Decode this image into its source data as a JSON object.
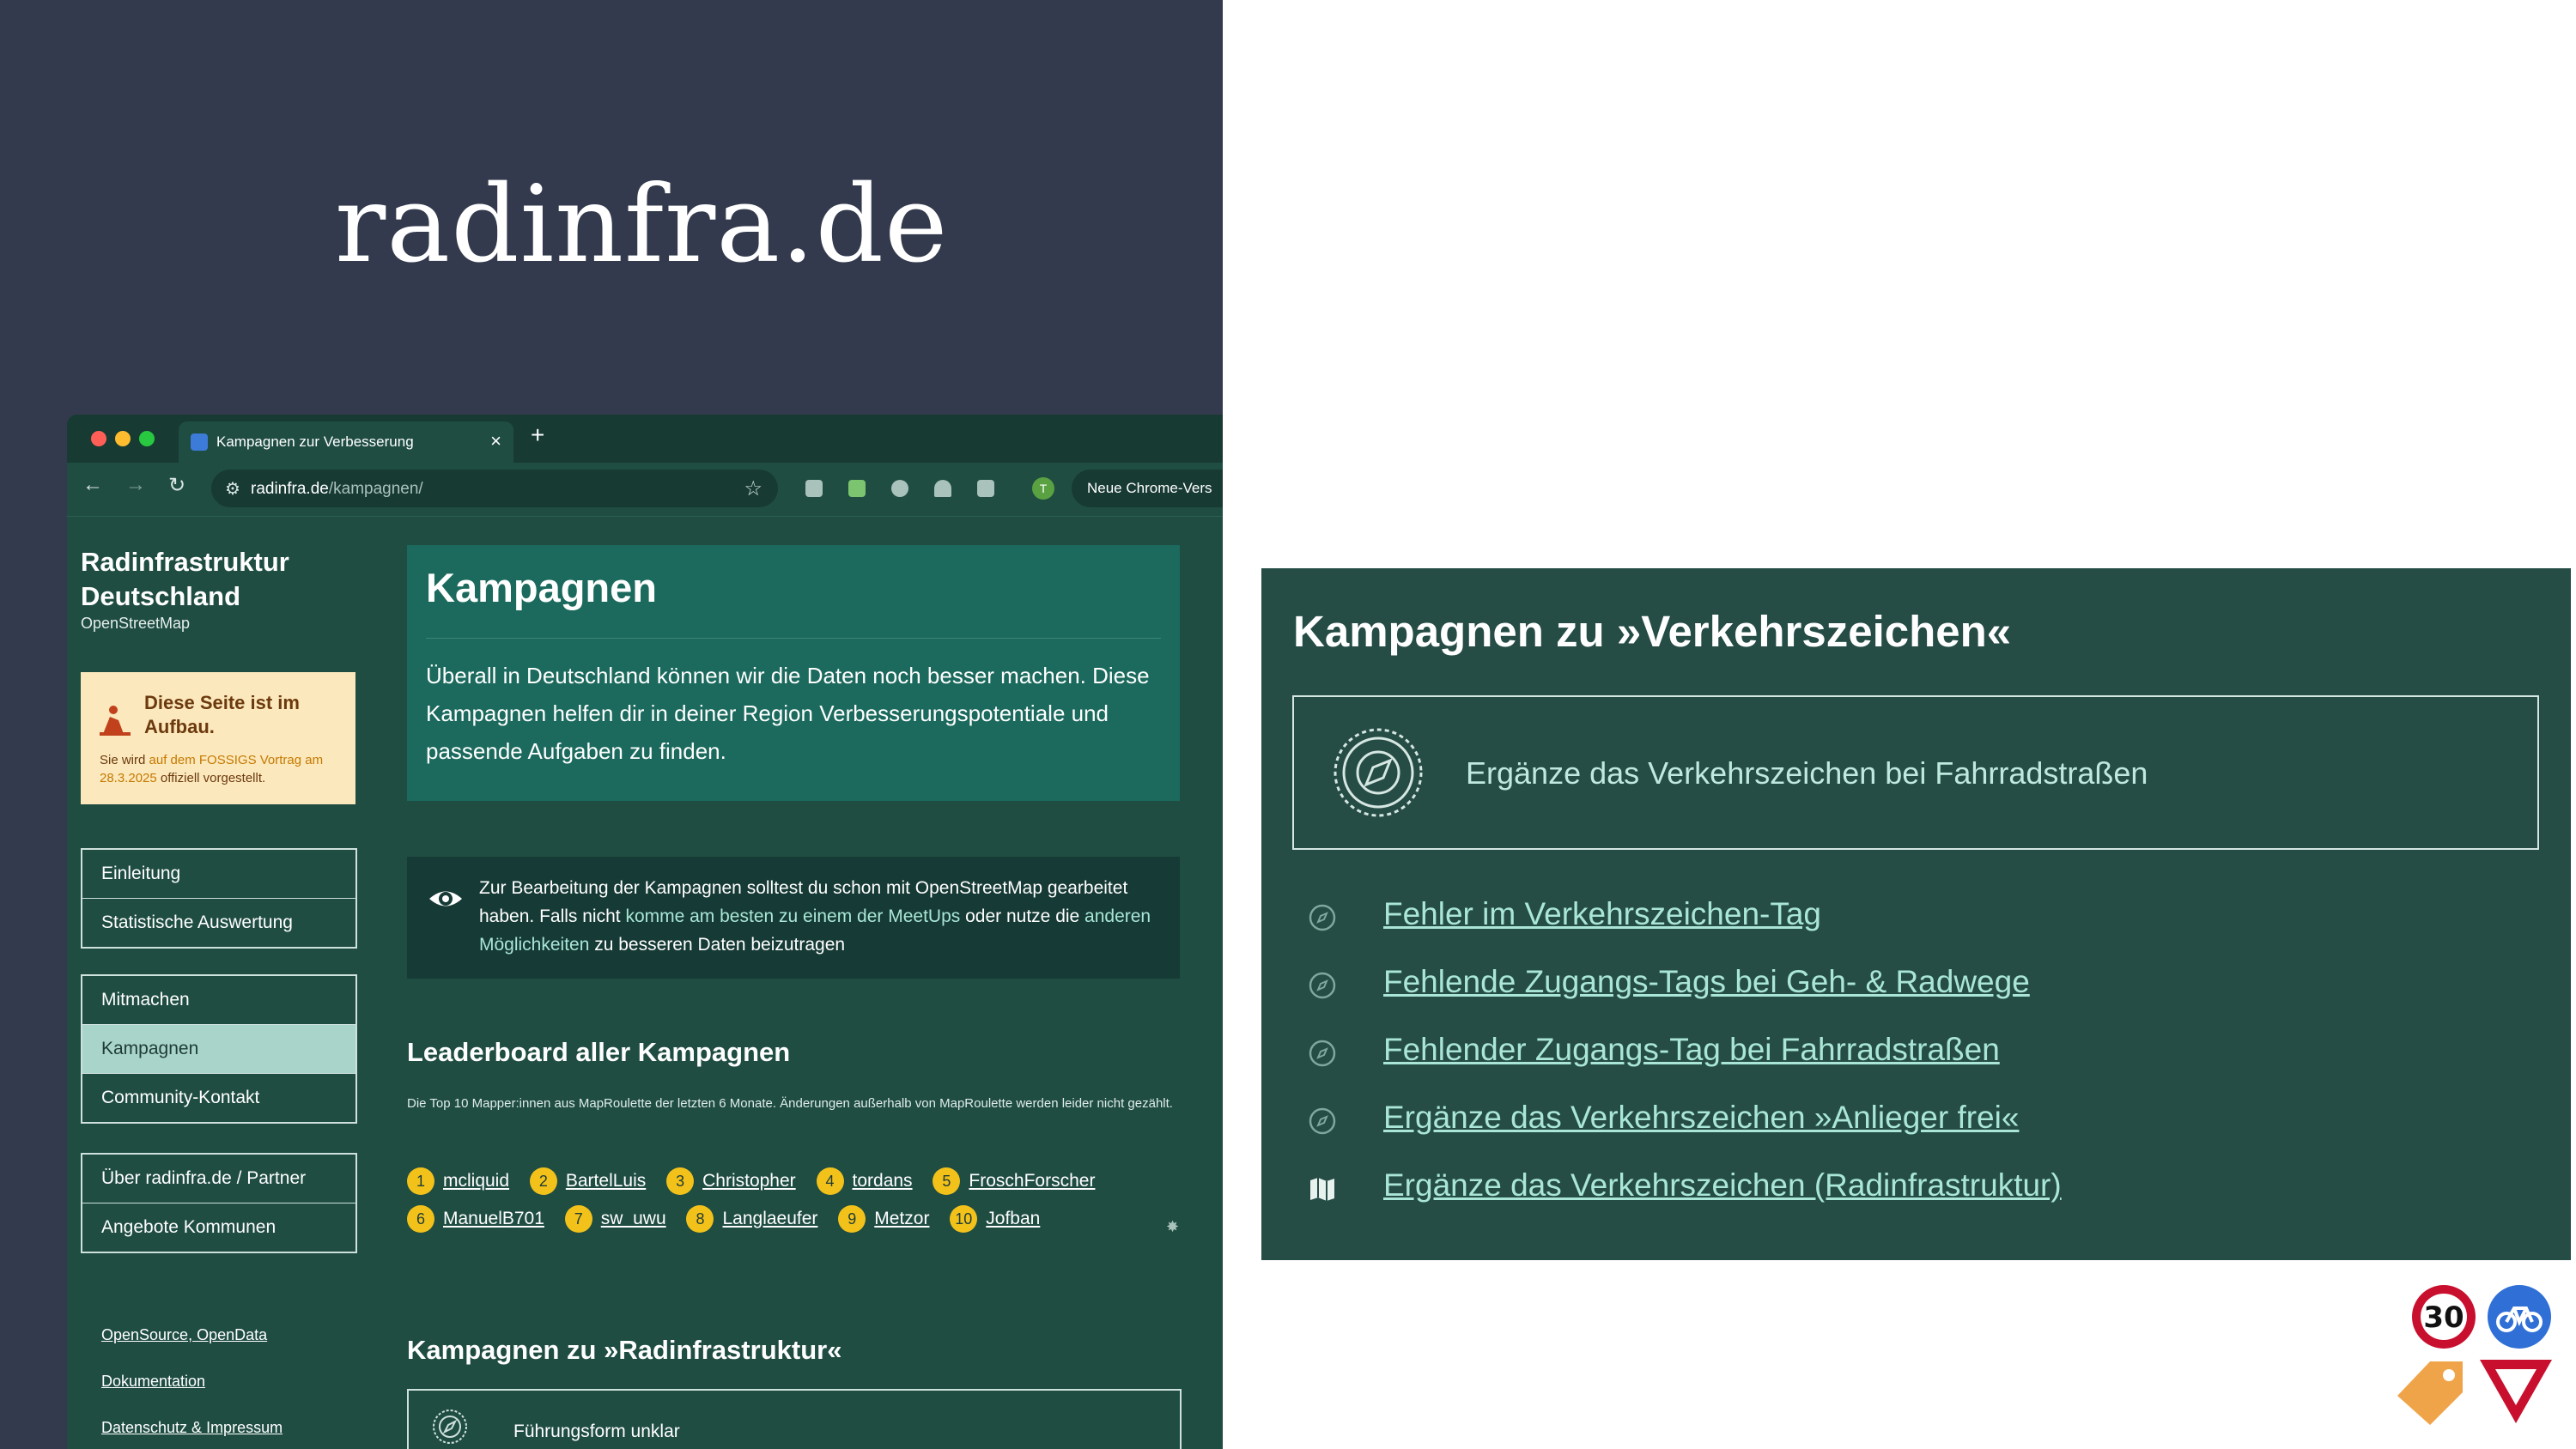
{
  "slide": {
    "title": "radinfra.de"
  },
  "browser": {
    "tab_title": "Kampagnen zur Verbesserung",
    "tab_close": "×",
    "tab_new": "+",
    "url_host": "radinfra.de",
    "url_path": "/kampagnen/",
    "avatar": "T",
    "chrome_button": "Neue Chrome-Vers"
  },
  "site": {
    "title": "Radinfrastruktur Deutschland",
    "subtitle": "OpenStreetMap",
    "notice": {
      "title": "Diese Seite ist im Aufbau.",
      "text_pre": "Sie wird ",
      "link": "auf dem FOSSIGS Vortrag am 28.3.2025",
      "text_post": " offiziell vorgestellt."
    },
    "nav_groups": [
      [
        "Einleitung",
        "Statistische Auswertung"
      ],
      [
        "Mitmachen",
        "Kampagnen",
        "Community-Kontakt"
      ],
      [
        "Über radinfra.de / Partner",
        "Angebote Kommunen"
      ]
    ],
    "footer_links": [
      "OpenSource, OpenData",
      "Dokumentation",
      "Datenschutz & Impressum"
    ],
    "hero": {
      "title": "Kampagnen",
      "text": "Überall in Deutschland können wir die Daten noch besser machen. Diese Kampagnen helfen dir in deiner Region Verbesserungspotentiale und passende Aufgaben zu finden."
    },
    "info": {
      "pre": "Zur Bearbeitung der Kampagnen solltest du schon mit OpenStreetMap gearbeitet haben. Falls nicht ",
      "link1": "komme am besten zu einem der MeetUps",
      "mid": " oder nutze die ",
      "link2": "anderen Möglichkeiten",
      "post": " zu besseren Daten beizutragen"
    },
    "leaderboard": {
      "title": "Leaderboard aller Kampagnen",
      "subtitle": "Die Top 10 Mapper:innen aus MapRoulette der letzten 6 Monate. Änderungen außerhalb von MapRoulette werden leider nicht gezählt.",
      "row1": [
        {
          "rank": "1",
          "name": "mcliquid"
        },
        {
          "rank": "2",
          "name": "BartelLuis"
        },
        {
          "rank": "3",
          "name": "Christopher"
        },
        {
          "rank": "4",
          "name": "tordans"
        },
        {
          "rank": "5",
          "name": "FroschForscher"
        }
      ],
      "row2": [
        {
          "rank": "6",
          "name": "ManuelB701"
        },
        {
          "rank": "7",
          "name": "sw_uwu"
        },
        {
          "rank": "8",
          "name": "Langlaeufer"
        },
        {
          "rank": "9",
          "name": "Metzor"
        },
        {
          "rank": "10",
          "name": "Jofban"
        }
      ]
    },
    "section_title": "Kampagnen zu »Radinfrastruktur«",
    "first_campaign": "Führungsform unklar"
  },
  "zoom": {
    "title": "Kampagnen zu »Verkehrszeichen«",
    "card": "Ergänze das Verkehrszeichen bei Fahrradstraßen",
    "items": [
      "Fehler im Verkehrszeichen-Tag",
      "Fehlende Zugangs-Tags bei Geh- & Radwege",
      "Fehlender Zugangs-Tag bei Fahrradstraßen",
      "Ergänze das Verkehrszeichen »Anlieger frei«",
      "Ergänze das Verkehrszeichen (Radinfrastruktur)"
    ]
  },
  "logos": {
    "speed": "30"
  }
}
